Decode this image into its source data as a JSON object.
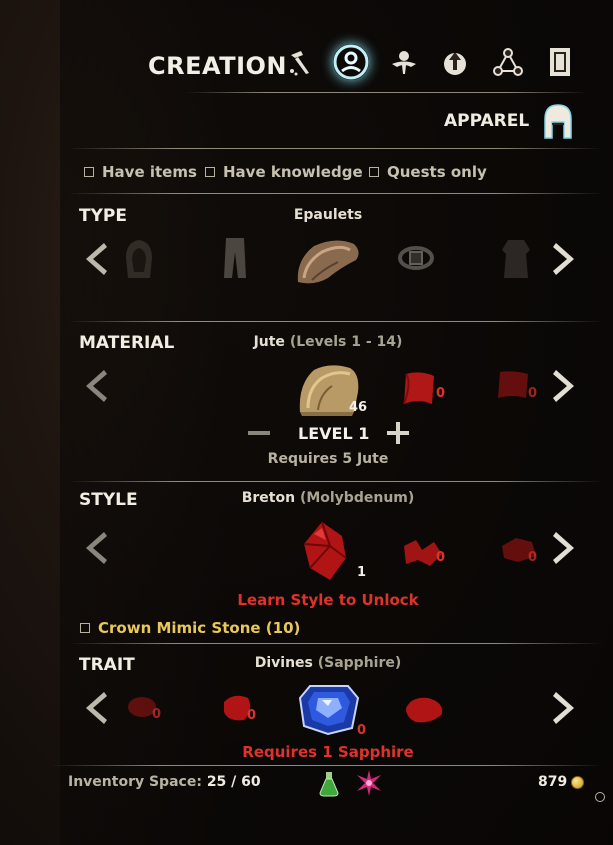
{
  "header": {
    "title": "CREATION",
    "tabs": [
      {
        "icon": "deconstruct-hammer-icon"
      },
      {
        "icon": "creation-icon",
        "active": true
      },
      {
        "icon": "improvement-icon"
      },
      {
        "icon": "upgrade-arrow-icon"
      },
      {
        "icon": "research-nodes-icon"
      },
      {
        "icon": "scroll-icon"
      }
    ]
  },
  "category": {
    "label": "APPAREL",
    "icon": "helmet-icon"
  },
  "filters": [
    {
      "label": "Have items",
      "checked": false
    },
    {
      "label": "Have knowledge",
      "checked": false
    },
    {
      "label": "Quests only",
      "checked": false
    }
  ],
  "type": {
    "label": "TYPE",
    "selected": "Epaulets",
    "items": [
      "hood-icon",
      "pants-icon",
      "epaulets-icon",
      "belt-icon",
      "robe-icon"
    ]
  },
  "material": {
    "label": "MATERIAL",
    "selected_name": "Jute",
    "selected_detail": "(Levels 1 - 14)",
    "selected_qty": "46",
    "other_qtys": [
      "0",
      "0"
    ],
    "level": "LEVEL 1",
    "requires": "Requires 5 Jute"
  },
  "style": {
    "label": "STYLE",
    "selected_name": "Breton",
    "selected_detail": "(Molybdenum)",
    "selected_qty": "1",
    "other_qtys": [
      "0",
      "0"
    ],
    "warning": "Learn Style to Unlock"
  },
  "mimic": {
    "label": "Crown Mimic Stone (10)",
    "checked": false
  },
  "trait": {
    "label": "TRAIT",
    "selected_name": "Divines",
    "selected_detail": "(Sapphire)",
    "selected_qty": "0",
    "other_qtys": [
      "0",
      "0",
      "0"
    ],
    "warning": "Requires 1 Sapphire"
  },
  "footer": {
    "inventory_label": "Inventory Space:",
    "inventory_value": "25 / 60",
    "gold": "879"
  },
  "colors": {
    "accent": "#7fd6e6",
    "warning": "#e0322a",
    "gold": "#e7c85a"
  }
}
